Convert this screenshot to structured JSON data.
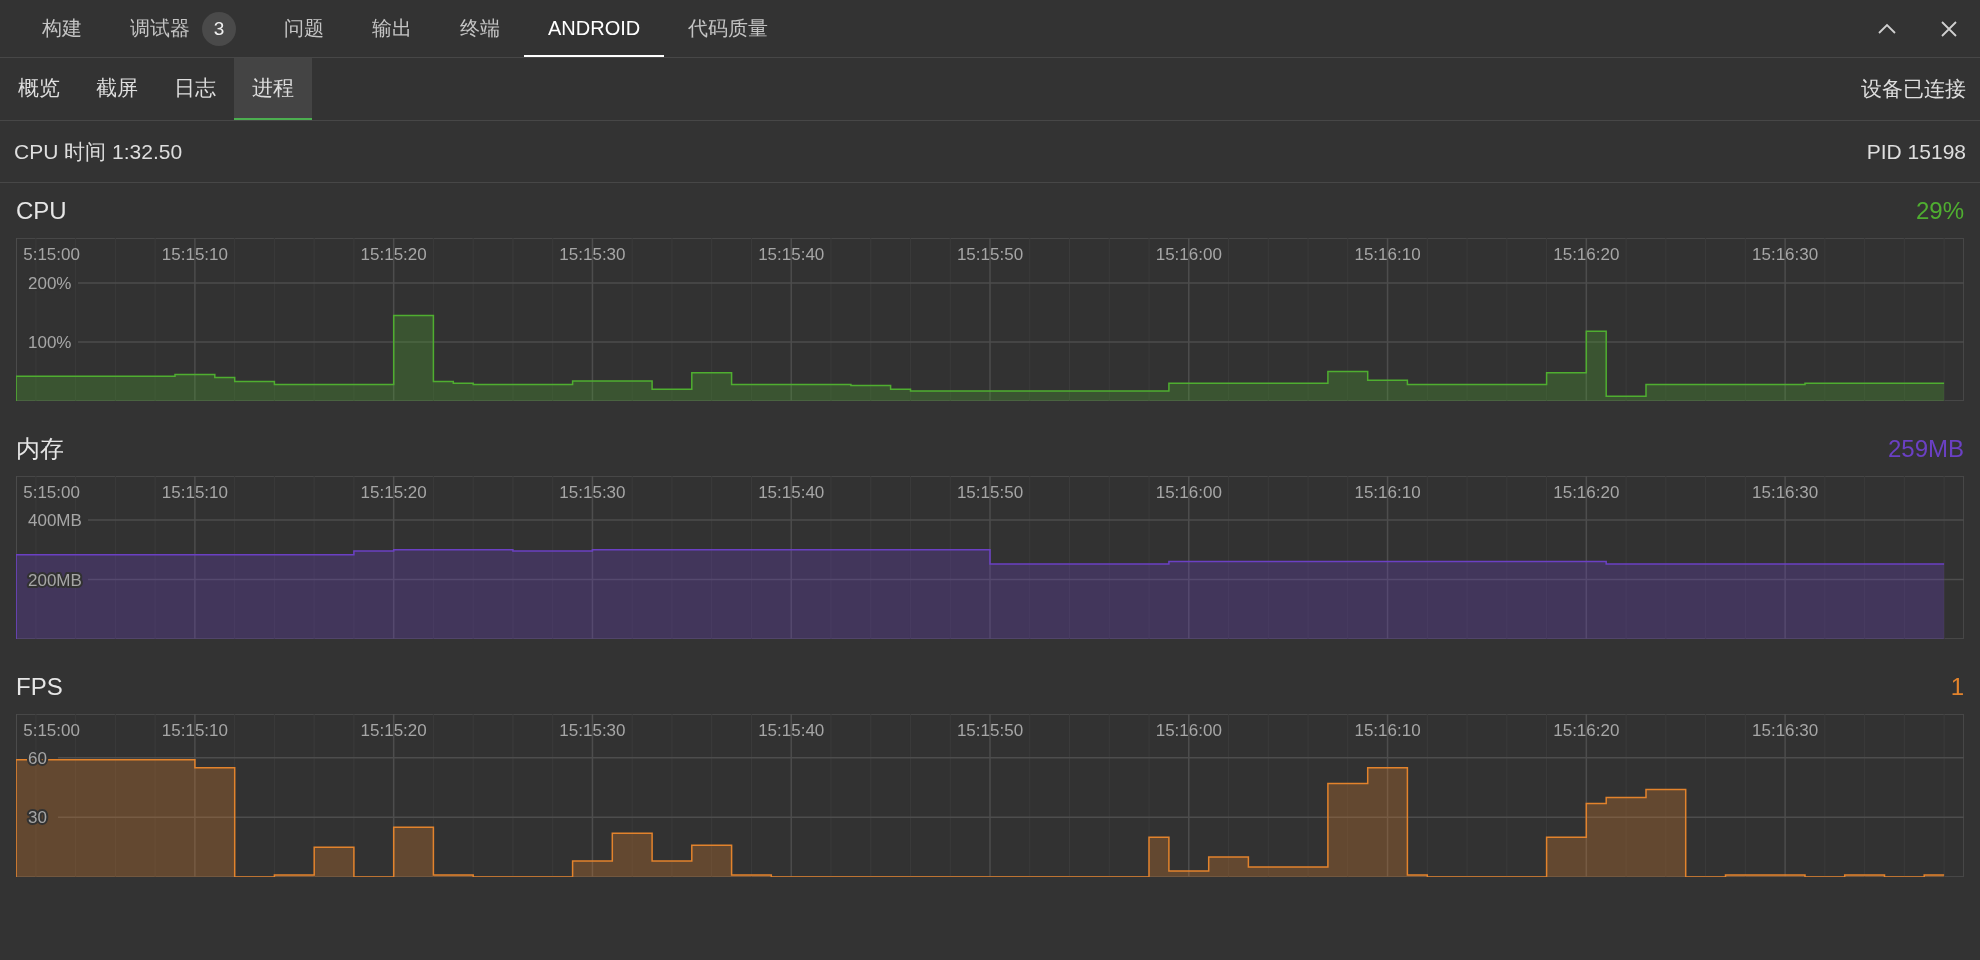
{
  "panel_tabs": [
    {
      "label": "构建",
      "selected": false
    },
    {
      "label": "调试器",
      "badge": "3",
      "selected": false
    },
    {
      "label": "问题",
      "selected": false
    },
    {
      "label": "输出",
      "selected": false
    },
    {
      "label": "终端",
      "selected": false
    },
    {
      "label": "ANDROID",
      "selected": true
    },
    {
      "label": "代码质量",
      "selected": false
    }
  ],
  "subtabs": [
    {
      "label": "概览",
      "selected": false
    },
    {
      "label": "截屏",
      "selected": false
    },
    {
      "label": "日志",
      "selected": false
    },
    {
      "label": "进程",
      "selected": true
    }
  ],
  "device_status": "设备已连接",
  "cpu_time": "CPU 时间 1:32.50",
  "pid": "PID 15198",
  "monitors": [
    {
      "value": "29%",
      "chart_data": {
        "type": "area",
        "grid": true,
        "ylim": [
          0,
          276
        ],
        "yticks": [
          {
            "value": 100,
            "label": "100%"
          },
          {
            "value": 200,
            "label": "200%"
          }
        ],
        "categories": [
          "5:15:00",
          null,
          null,
          null,
          null,
          null,
          null,
          null,
          null,
          "15:15:10",
          null,
          null,
          null,
          null,
          null,
          null,
          null,
          null,
          null,
          "15:15:20",
          null,
          null,
          null,
          null,
          null,
          null,
          null,
          null,
          null,
          "15:15:30",
          null,
          null,
          null,
          null,
          null,
          null,
          null,
          null,
          null,
          "15:15:40",
          null,
          null,
          null,
          null,
          null,
          null,
          null,
          null,
          null,
          "15:15:50",
          null,
          null,
          null,
          null,
          null,
          null,
          null,
          null,
          null,
          "15:16:00",
          null,
          null,
          null,
          null,
          null,
          null,
          null,
          null,
          null,
          "15:16:10",
          null,
          null,
          null,
          null,
          null,
          null,
          null,
          null,
          null,
          "15:16:20",
          null,
          null,
          null,
          null,
          null,
          null,
          null,
          null,
          null,
          "15:16:30",
          null,
          null,
          null,
          null,
          null,
          null,
          null,
          null
        ],
        "series": [
          {
            "name": "CPU",
            "color": "#4fae30",
            "values": [
              42,
              42,
              42,
              42,
              42,
              42,
              42,
              42,
              45,
              45,
              40,
              33,
              33,
              28,
              28,
              28,
              28,
              28,
              28,
              145,
              145,
              33,
              30,
              28,
              28,
              28,
              28,
              28,
              34,
              34,
              34,
              34,
              20,
              20,
              48,
              48,
              28,
              28,
              28,
              28,
              28,
              28,
              26,
              26,
              20,
              17,
              17,
              17,
              17,
              17,
              17,
              17,
              17,
              17,
              17,
              17,
              17,
              17,
              30,
              30,
              30,
              30,
              30,
              30,
              30,
              30,
              50,
              50,
              35,
              35,
              28,
              28,
              28,
              28,
              28,
              28,
              28,
              48,
              48,
              118,
              8,
              8,
              28,
              28,
              28,
              28,
              28,
              28,
              28,
              28,
              30,
              30,
              30,
              30,
              30,
              30,
              30,
              30
            ]
          }
        ]
      }
    },
    {
      "value": "259MB",
      "chart_data": {
        "type": "area",
        "grid": true,
        "ylim": [
          0,
          548
        ],
        "yticks": [
          {
            "value": 200,
            "label": "200MB"
          },
          {
            "value": 400,
            "label": "400MB"
          }
        ],
        "categories": [
          "5:15:00",
          null,
          null,
          null,
          null,
          null,
          null,
          null,
          null,
          "15:15:10",
          null,
          null,
          null,
          null,
          null,
          null,
          null,
          null,
          null,
          "15:15:20",
          null,
          null,
          null,
          null,
          null,
          null,
          null,
          null,
          null,
          "15:15:30",
          null,
          null,
          null,
          null,
          null,
          null,
          null,
          null,
          null,
          "15:15:40",
          null,
          null,
          null,
          null,
          null,
          null,
          null,
          null,
          null,
          "15:15:50",
          null,
          null,
          null,
          null,
          null,
          null,
          null,
          null,
          null,
          "15:16:00",
          null,
          null,
          null,
          null,
          null,
          null,
          null,
          null,
          null,
          "15:16:10",
          null,
          null,
          null,
          null,
          null,
          null,
          null,
          null,
          null,
          "15:16:20",
          null,
          null,
          null,
          null,
          null,
          null,
          null,
          null,
          null,
          "15:16:30",
          null,
          null,
          null,
          null,
          null,
          null,
          null,
          null
        ],
        "series": [
          {
            "name": "内存",
            "color": "#6b40c4",
            "values": [
              283,
              283,
              283,
              283,
              283,
              283,
              283,
              283,
              283,
              283,
              283,
              283,
              283,
              283,
              283,
              283,
              283,
              296,
              296,
              300,
              300,
              300,
              300,
              300,
              300,
              296,
              296,
              296,
              296,
              300,
              300,
              300,
              300,
              300,
              300,
              300,
              300,
              300,
              300,
              300,
              300,
              300,
              300,
              300,
              300,
              300,
              300,
              300,
              300,
              252,
              252,
              252,
              252,
              252,
              252,
              252,
              252,
              252,
              261,
              261,
              261,
              261,
              261,
              261,
              261,
              261,
              261,
              261,
              261,
              261,
              261,
              261,
              261,
              261,
              261,
              261,
              261,
              261,
              261,
              261,
              252,
              252,
              252,
              252,
              252,
              252,
              252,
              252,
              252,
              252,
              252,
              252,
              252,
              252,
              252,
              252,
              252,
              252
            ]
          }
        ]
      }
    },
    {
      "value": "1",
      "chart_data": {
        "type": "area",
        "grid": true,
        "ylim": [
          0,
          82
        ],
        "yticks": [
          30,
          60
        ],
        "categories": [
          "5:15:00",
          null,
          null,
          null,
          null,
          null,
          null,
          null,
          null,
          "15:15:10",
          null,
          null,
          null,
          null,
          null,
          null,
          null,
          null,
          null,
          "15:15:20",
          null,
          null,
          null,
          null,
          null,
          null,
          null,
          null,
          null,
          "15:15:30",
          null,
          null,
          null,
          null,
          null,
          null,
          null,
          null,
          null,
          "15:15:40",
          null,
          null,
          null,
          null,
          null,
          null,
          null,
          null,
          null,
          "15:15:50",
          null,
          null,
          null,
          null,
          null,
          null,
          null,
          null,
          null,
          "15:16:00",
          null,
          null,
          null,
          null,
          null,
          null,
          null,
          null,
          null,
          "15:16:10",
          null,
          null,
          null,
          null,
          null,
          null,
          null,
          null,
          null,
          "15:16:20",
          null,
          null,
          null,
          null,
          null,
          null,
          null,
          null,
          null,
          "15:16:30",
          null,
          null,
          null,
          null,
          null,
          null,
          null,
          null
        ],
        "series": [
          {
            "name": "FPS",
            "color": "#e3832c",
            "values": [
              59,
              59,
              59,
              59,
              59,
              59,
              59,
              59,
              59,
              55,
              55,
              0,
              0,
              1,
              1,
              15,
              15,
              0,
              0,
              25,
              25,
              1,
              1,
              0,
              0,
              0,
              0,
              0,
              8,
              8,
              22,
              22,
              8,
              8,
              16,
              16,
              1,
              1,
              0,
              0,
              0,
              0,
              0,
              0,
              0,
              0,
              0,
              0,
              0,
              0,
              0,
              0,
              0,
              0,
              0,
              0,
              0,
              20,
              3,
              3,
              10,
              10,
              5,
              5,
              5,
              5,
              47,
              47,
              55,
              55,
              1,
              0,
              0,
              0,
              0,
              0,
              0,
              20,
              20,
              37,
              40,
              40,
              44,
              44,
              0,
              0,
              1,
              1,
              1,
              1,
              0,
              0,
              1,
              1,
              0,
              0,
              1,
              1
            ]
          }
        ]
      }
    }
  ]
}
